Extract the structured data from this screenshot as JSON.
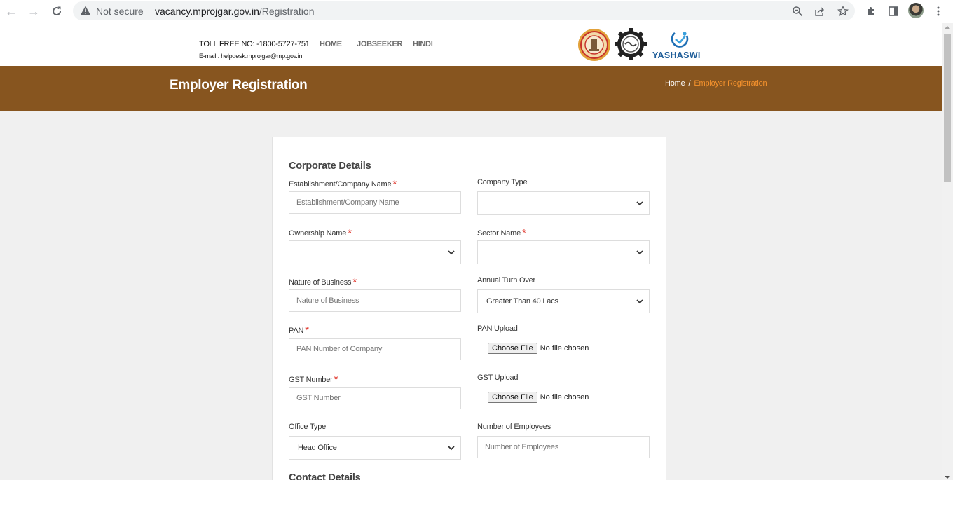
{
  "browser": {
    "security_label": "Not secure",
    "url_host": "vacancy.mprojgar.gov.in",
    "url_path": "/Registration",
    "icons": [
      "back-icon",
      "forward-icon",
      "reload-icon",
      "warning-icon",
      "zoom-out-icon",
      "share-icon",
      "bookmark-star-icon",
      "extensions-icon",
      "side-panel-icon",
      "profile-avatar",
      "menu-kebab-icon"
    ]
  },
  "header": {
    "toll_free": "TOLL FREE NO: -1800-5727-751",
    "email": "E-mail : helpdesk.mprojgar@mp.gov.in",
    "nav": [
      "HOME",
      "JOBSEEKER",
      "HINDI"
    ],
    "logos": [
      "mp-government-emblem",
      "employment-department-gear-logo",
      "yashaswi-logo"
    ],
    "yashaswi_text": "YASHASWI"
  },
  "banner": {
    "title": "Employer Registration",
    "breadcrumb": {
      "home": "Home",
      "separator": "/",
      "current": "Employer Registration"
    }
  },
  "colors": {
    "banner_bg": "#87551f",
    "breadcrumb_active": "#f7932d",
    "required_star": "#e0362c"
  },
  "form": {
    "section_corporate": "Corporate Details",
    "section_contact": "Contact Details",
    "required_mark": "*",
    "fields": {
      "company_name": {
        "label": "Establishment/Company Name",
        "placeholder": "Establishment/Company Name",
        "required": true
      },
      "company_type": {
        "label": "Company Type",
        "value": "",
        "required": false
      },
      "ownership_name": {
        "label": "Ownership Name",
        "value": "",
        "required": true
      },
      "sector_name": {
        "label": "Sector Name",
        "value": "",
        "required": true
      },
      "nature_of_business": {
        "label": "Nature of Business",
        "placeholder": "Nature of Business",
        "required": true
      },
      "annual_turnover": {
        "label": "Annual Turn Over",
        "value": "Greater Than 40 Lacs",
        "required": false
      },
      "pan": {
        "label": "PAN",
        "placeholder": "PAN Number of Company",
        "required": true
      },
      "pan_upload": {
        "label": "PAN Upload",
        "button": "Choose File",
        "status": "No file chosen"
      },
      "gst_number": {
        "label": "GST Number",
        "placeholder": "GST Number",
        "required": true
      },
      "gst_upload": {
        "label": "GST Upload",
        "button": "Choose File",
        "status": "No file chosen"
      },
      "office_type": {
        "label": "Office Type",
        "value": "Head Office",
        "required": false
      },
      "num_employees": {
        "label": "Number of Employees",
        "placeholder": "Number of Employees",
        "required": false
      }
    }
  }
}
